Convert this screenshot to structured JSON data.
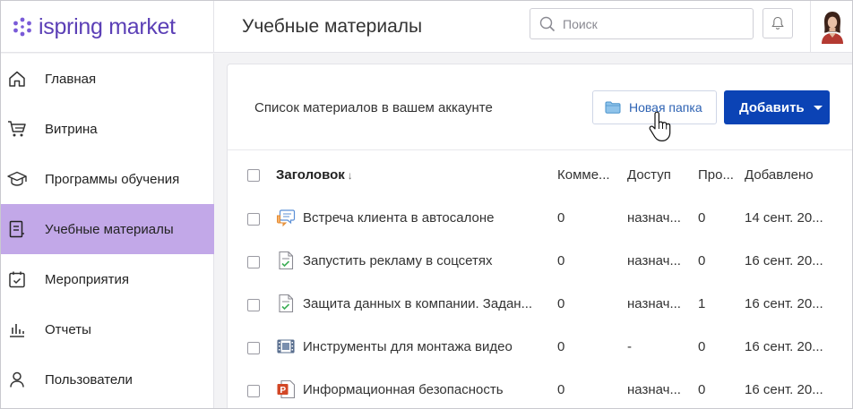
{
  "app": {
    "logo_text": "ispring market"
  },
  "header": {
    "title": "Учебные материалы",
    "search_placeholder": "Поиск"
  },
  "sidebar": {
    "items": [
      {
        "label": "Главная",
        "icon": "home-icon",
        "active": false
      },
      {
        "label": "Витрина",
        "icon": "cart-icon",
        "active": false
      },
      {
        "label": "Программы обучения",
        "icon": "graduation-cap-icon",
        "active": false
      },
      {
        "label": "Учебные материалы",
        "icon": "document-icon",
        "active": true
      },
      {
        "label": "Мероприятия",
        "icon": "calendar-check-icon",
        "active": false
      },
      {
        "label": "Отчеты",
        "icon": "bar-chart-icon",
        "active": false
      },
      {
        "label": "Пользователи",
        "icon": "user-icon",
        "active": false
      }
    ]
  },
  "content": {
    "subtitle": "Список материалов в вашем аккаунте",
    "new_folder_label": "Новая папка",
    "add_label": "Добавить"
  },
  "table": {
    "columns": {
      "title": "Заголовок",
      "sort_indicator": "↓",
      "comments": "Комме...",
      "access": "Доступ",
      "views": "Про...",
      "added": "Добавлено"
    },
    "rows": [
      {
        "type_icon": "dialogue-simulation-icon",
        "title": "Встреча клиента в автосалоне",
        "comments": "0",
        "access": "назнач...",
        "views": "0",
        "added": "14 сент. 20..."
      },
      {
        "type_icon": "quiz-icon",
        "title": "Запустить рекламу в соцсетях",
        "comments": "0",
        "access": "назнач...",
        "views": "0",
        "added": "16 сент. 20..."
      },
      {
        "type_icon": "quiz-icon",
        "title": "Защита данных в компании. Задан...",
        "comments": "0",
        "access": "назнач...",
        "views": "1",
        "added": "16 сент. 20..."
      },
      {
        "type_icon": "video-icon",
        "title": "Инструменты для монтажа видео",
        "comments": "0",
        "access": "-",
        "views": "0",
        "added": "16 сент. 20..."
      },
      {
        "type_icon": "powerpoint-icon",
        "title": "Информационная безопасность",
        "comments": "0",
        "access": "назнач...",
        "views": "0",
        "added": "16 сент. 20..."
      }
    ]
  },
  "colors": {
    "brand": "#5b3fb6",
    "active_nav": "#c2a8e8",
    "primary_button": "#0b43b5",
    "link": "#2d62b3"
  }
}
